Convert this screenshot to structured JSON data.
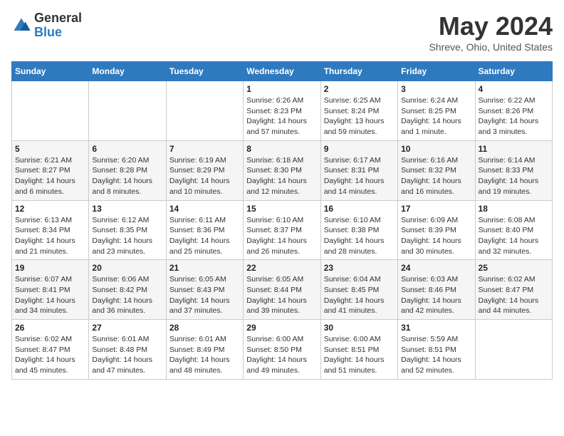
{
  "header": {
    "logo_general": "General",
    "logo_blue": "Blue",
    "title": "May 2024",
    "location": "Shreve, Ohio, United States"
  },
  "weekdays": [
    "Sunday",
    "Monday",
    "Tuesday",
    "Wednesday",
    "Thursday",
    "Friday",
    "Saturday"
  ],
  "weeks": [
    [
      {
        "day": "",
        "sunrise": "",
        "sunset": "",
        "daylight": ""
      },
      {
        "day": "",
        "sunrise": "",
        "sunset": "",
        "daylight": ""
      },
      {
        "day": "",
        "sunrise": "",
        "sunset": "",
        "daylight": ""
      },
      {
        "day": "1",
        "sunrise": "Sunrise: 6:26 AM",
        "sunset": "Sunset: 8:23 PM",
        "daylight": "Daylight: 14 hours and 57 minutes."
      },
      {
        "day": "2",
        "sunrise": "Sunrise: 6:25 AM",
        "sunset": "Sunset: 8:24 PM",
        "daylight": "Daylight: 13 hours and 59 minutes."
      },
      {
        "day": "3",
        "sunrise": "Sunrise: 6:24 AM",
        "sunset": "Sunset: 8:25 PM",
        "daylight": "Daylight: 14 hours and 1 minute."
      },
      {
        "day": "4",
        "sunrise": "Sunrise: 6:22 AM",
        "sunset": "Sunset: 8:26 PM",
        "daylight": "Daylight: 14 hours and 3 minutes."
      }
    ],
    [
      {
        "day": "5",
        "sunrise": "Sunrise: 6:21 AM",
        "sunset": "Sunset: 8:27 PM",
        "daylight": "Daylight: 14 hours and 6 minutes."
      },
      {
        "day": "6",
        "sunrise": "Sunrise: 6:20 AM",
        "sunset": "Sunset: 8:28 PM",
        "daylight": "Daylight: 14 hours and 8 minutes."
      },
      {
        "day": "7",
        "sunrise": "Sunrise: 6:19 AM",
        "sunset": "Sunset: 8:29 PM",
        "daylight": "Daylight: 14 hours and 10 minutes."
      },
      {
        "day": "8",
        "sunrise": "Sunrise: 6:18 AM",
        "sunset": "Sunset: 8:30 PM",
        "daylight": "Daylight: 14 hours and 12 minutes."
      },
      {
        "day": "9",
        "sunrise": "Sunrise: 6:17 AM",
        "sunset": "Sunset: 8:31 PM",
        "daylight": "Daylight: 14 hours and 14 minutes."
      },
      {
        "day": "10",
        "sunrise": "Sunrise: 6:16 AM",
        "sunset": "Sunset: 8:32 PM",
        "daylight": "Daylight: 14 hours and 16 minutes."
      },
      {
        "day": "11",
        "sunrise": "Sunrise: 6:14 AM",
        "sunset": "Sunset: 8:33 PM",
        "daylight": "Daylight: 14 hours and 19 minutes."
      }
    ],
    [
      {
        "day": "12",
        "sunrise": "Sunrise: 6:13 AM",
        "sunset": "Sunset: 8:34 PM",
        "daylight": "Daylight: 14 hours and 21 minutes."
      },
      {
        "day": "13",
        "sunrise": "Sunrise: 6:12 AM",
        "sunset": "Sunset: 8:35 PM",
        "daylight": "Daylight: 14 hours and 23 minutes."
      },
      {
        "day": "14",
        "sunrise": "Sunrise: 6:11 AM",
        "sunset": "Sunset: 8:36 PM",
        "daylight": "Daylight: 14 hours and 25 minutes."
      },
      {
        "day": "15",
        "sunrise": "Sunrise: 6:10 AM",
        "sunset": "Sunset: 8:37 PM",
        "daylight": "Daylight: 14 hours and 26 minutes."
      },
      {
        "day": "16",
        "sunrise": "Sunrise: 6:10 AM",
        "sunset": "Sunset: 8:38 PM",
        "daylight": "Daylight: 14 hours and 28 minutes."
      },
      {
        "day": "17",
        "sunrise": "Sunrise: 6:09 AM",
        "sunset": "Sunset: 8:39 PM",
        "daylight": "Daylight: 14 hours and 30 minutes."
      },
      {
        "day": "18",
        "sunrise": "Sunrise: 6:08 AM",
        "sunset": "Sunset: 8:40 PM",
        "daylight": "Daylight: 14 hours and 32 minutes."
      }
    ],
    [
      {
        "day": "19",
        "sunrise": "Sunrise: 6:07 AM",
        "sunset": "Sunset: 8:41 PM",
        "daylight": "Daylight: 14 hours and 34 minutes."
      },
      {
        "day": "20",
        "sunrise": "Sunrise: 6:06 AM",
        "sunset": "Sunset: 8:42 PM",
        "daylight": "Daylight: 14 hours and 36 minutes."
      },
      {
        "day": "21",
        "sunrise": "Sunrise: 6:05 AM",
        "sunset": "Sunset: 8:43 PM",
        "daylight": "Daylight: 14 hours and 37 minutes."
      },
      {
        "day": "22",
        "sunrise": "Sunrise: 6:05 AM",
        "sunset": "Sunset: 8:44 PM",
        "daylight": "Daylight: 14 hours and 39 minutes."
      },
      {
        "day": "23",
        "sunrise": "Sunrise: 6:04 AM",
        "sunset": "Sunset: 8:45 PM",
        "daylight": "Daylight: 14 hours and 41 minutes."
      },
      {
        "day": "24",
        "sunrise": "Sunrise: 6:03 AM",
        "sunset": "Sunset: 8:46 PM",
        "daylight": "Daylight: 14 hours and 42 minutes."
      },
      {
        "day": "25",
        "sunrise": "Sunrise: 6:02 AM",
        "sunset": "Sunset: 8:47 PM",
        "daylight": "Daylight: 14 hours and 44 minutes."
      }
    ],
    [
      {
        "day": "26",
        "sunrise": "Sunrise: 6:02 AM",
        "sunset": "Sunset: 8:47 PM",
        "daylight": "Daylight: 14 hours and 45 minutes."
      },
      {
        "day": "27",
        "sunrise": "Sunrise: 6:01 AM",
        "sunset": "Sunset: 8:48 PM",
        "daylight": "Daylight: 14 hours and 47 minutes."
      },
      {
        "day": "28",
        "sunrise": "Sunrise: 6:01 AM",
        "sunset": "Sunset: 8:49 PM",
        "daylight": "Daylight: 14 hours and 48 minutes."
      },
      {
        "day": "29",
        "sunrise": "Sunrise: 6:00 AM",
        "sunset": "Sunset: 8:50 PM",
        "daylight": "Daylight: 14 hours and 49 minutes."
      },
      {
        "day": "30",
        "sunrise": "Sunrise: 6:00 AM",
        "sunset": "Sunset: 8:51 PM",
        "daylight": "Daylight: 14 hours and 51 minutes."
      },
      {
        "day": "31",
        "sunrise": "Sunrise: 5:59 AM",
        "sunset": "Sunset: 8:51 PM",
        "daylight": "Daylight: 14 hours and 52 minutes."
      },
      {
        "day": "",
        "sunrise": "",
        "sunset": "",
        "daylight": ""
      }
    ]
  ]
}
